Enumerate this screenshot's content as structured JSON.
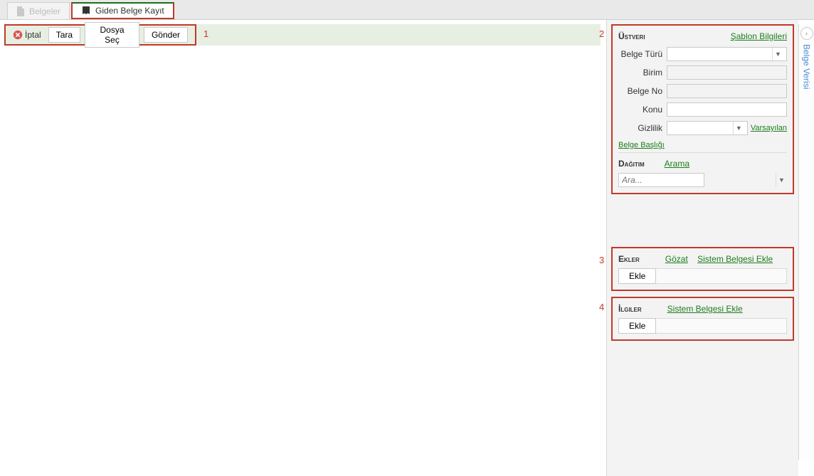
{
  "tabs": {
    "inactive": "Belgeler",
    "active": "Giden Belge Kayıt"
  },
  "toolbar": {
    "cancel": "İptal",
    "scan": "Tara",
    "choose_file": "Dosya Seç",
    "send": "Gönder"
  },
  "annotations": {
    "a1": "1",
    "a2": "2",
    "a3": "3",
    "a4": "4"
  },
  "sidetab": {
    "label": "Belge Verisi",
    "chevron": "›"
  },
  "ustveri": {
    "title": "Üstveri",
    "link_sablon": "Şablon Bilgileri",
    "fields": {
      "belge_turu": {
        "label": "Belge Türü",
        "value": ""
      },
      "birim": {
        "label": "Birim",
        "value": ""
      },
      "belge_no": {
        "label": "Belge No",
        "value": ""
      },
      "konu": {
        "label": "Konu",
        "value": ""
      },
      "gizlilik": {
        "label": "Gizlilik",
        "value": "",
        "default_link": "Varsayılan"
      }
    },
    "belge_basligi": "Belge Başlığı"
  },
  "dagitim": {
    "title": "Dağıtım",
    "link_arama": "Arama",
    "search_placeholder": "Ara...",
    "select_value": ""
  },
  "ekler": {
    "title": "Ekler",
    "link_gozat": "Gözat",
    "link_sistem": "Sistem Belgesi Ekle",
    "ekle": "Ekle"
  },
  "ilgiler": {
    "title": "İlgiler",
    "link_sistem": "Sistem Belgesi Ekle",
    "ekle": "Ekle"
  }
}
